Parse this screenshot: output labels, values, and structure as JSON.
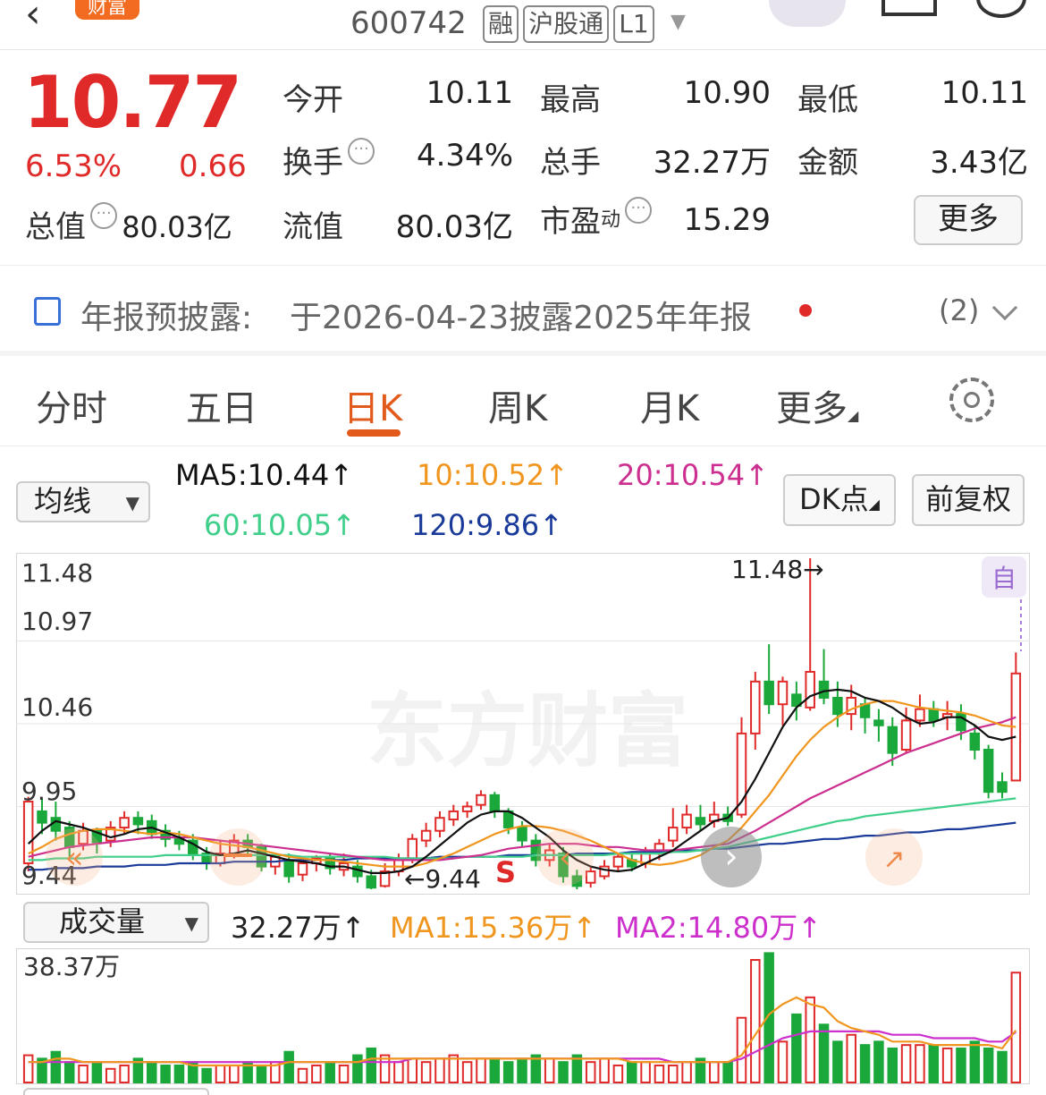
{
  "header": {
    "logo_text": "财富",
    "stock_code": "600742",
    "tags": [
      "融",
      "沪股通",
      "L1"
    ]
  },
  "quote": {
    "price": "10.77",
    "change_pct": "6.53%",
    "change_amt": "0.66",
    "market_cap_label": "总值",
    "market_cap": "80.03亿",
    "open_label": "今开",
    "open": "10.11",
    "high_label": "最高",
    "high": "10.90",
    "low_label": "最低",
    "low": "10.11",
    "turnover_label": "换手",
    "turnover": "4.34%",
    "volume_label": "总手",
    "volume": "32.27万",
    "amount_label": "金额",
    "amount": "3.43亿",
    "float_cap_label": "流值",
    "float_cap": "80.03亿",
    "pe_label": "市盈",
    "pe_sup": "动",
    "pe": "15.29",
    "more_label": "更多"
  },
  "notice": {
    "title": "年报预披露:",
    "text": "于2026-04-23披露2025年年报",
    "count": "(2)"
  },
  "tabs": [
    "分时",
    "五日",
    "日K",
    "周K",
    "月K",
    "更多"
  ],
  "active_tab": "日K",
  "indicators": {
    "select_label": "均线",
    "ma5": "MA5:10.44↑",
    "ma10": "10:10.52↑",
    "ma20": "20:10.54↑",
    "ma60": "60:10.05↑",
    "ma120": "120:9.86↑",
    "dk_label": "DK点",
    "adjust_label": "前复权"
  },
  "kchart": {
    "y_labels": [
      "11.48",
      "10.97",
      "10.46",
      "9.95",
      "9.44"
    ],
    "max_marker": "11.48→",
    "min_marker": "←9.44",
    "s_marker": "S",
    "auto_label": "自",
    "watermark": "东方财富"
  },
  "volume": {
    "select_label": "成交量",
    "current": "32.27万↑",
    "ma1": "MA1:15.36万↑",
    "ma2": "MA2:14.80万↑",
    "max_label": "38.37万"
  },
  "colors": {
    "up": "#e02a2a",
    "down": "#1aa83a",
    "ma5": "#111111",
    "ma10": "#f0961e",
    "ma20": "#cc2f8f",
    "ma60": "#3fcf8a",
    "ma120": "#1a3a9a",
    "accent": "#e25a1c"
  },
  "chart_data": {
    "type": "candlestick",
    "ylim": [
      9.44,
      11.48
    ],
    "candles": [
      {
        "o": 9.6,
        "c": 9.98,
        "h": 10.01,
        "l": 9.55
      },
      {
        "o": 9.92,
        "c": 9.85,
        "h": 10.0,
        "l": 9.78
      },
      {
        "o": 9.88,
        "c": 9.8,
        "h": 9.98,
        "l": 9.74
      },
      {
        "o": 9.82,
        "c": 9.7,
        "h": 9.86,
        "l": 9.64
      },
      {
        "o": 9.72,
        "c": 9.8,
        "h": 9.85,
        "l": 9.68
      },
      {
        "o": 9.8,
        "c": 9.73,
        "h": 9.82,
        "l": 9.66
      },
      {
        "o": 9.74,
        "c": 9.82,
        "h": 9.86,
        "l": 9.7
      },
      {
        "o": 9.82,
        "c": 9.88,
        "h": 9.92,
        "l": 9.78
      },
      {
        "o": 9.88,
        "c": 9.84,
        "h": 9.92,
        "l": 9.78
      },
      {
        "o": 9.86,
        "c": 9.78,
        "h": 9.9,
        "l": 9.75
      },
      {
        "o": 9.8,
        "c": 9.75,
        "h": 9.84,
        "l": 9.7
      },
      {
        "o": 9.76,
        "c": 9.72,
        "h": 9.8,
        "l": 9.68
      },
      {
        "o": 9.74,
        "c": 9.66,
        "h": 9.78,
        "l": 9.62
      },
      {
        "o": 9.66,
        "c": 9.6,
        "h": 9.7,
        "l": 9.56
      },
      {
        "o": 9.6,
        "c": 9.66,
        "h": 9.74,
        "l": 9.58
      },
      {
        "o": 9.66,
        "c": 9.74,
        "h": 9.78,
        "l": 9.63
      },
      {
        "o": 9.74,
        "c": 9.7,
        "h": 9.78,
        "l": 9.66
      },
      {
        "o": 9.7,
        "c": 9.58,
        "h": 9.72,
        "l": 9.55
      },
      {
        "o": 9.58,
        "c": 9.64,
        "h": 9.66,
        "l": 9.53
      },
      {
        "o": 9.62,
        "c": 9.52,
        "h": 9.66,
        "l": 9.48
      },
      {
        "o": 9.53,
        "c": 9.6,
        "h": 9.64,
        "l": 9.49
      },
      {
        "o": 9.6,
        "c": 9.63,
        "h": 9.65,
        "l": 9.55
      },
      {
        "o": 9.63,
        "c": 9.57,
        "h": 9.66,
        "l": 9.53
      },
      {
        "o": 9.56,
        "c": 9.6,
        "h": 9.66,
        "l": 9.52
      },
      {
        "o": 9.58,
        "c": 9.52,
        "h": 9.62,
        "l": 9.48
      },
      {
        "o": 9.52,
        "c": 9.45,
        "h": 9.56,
        "l": 9.44
      },
      {
        "o": 9.46,
        "c": 9.55,
        "h": 9.6,
        "l": 9.45
      },
      {
        "o": 9.55,
        "c": 9.63,
        "h": 9.66,
        "l": 9.52
      },
      {
        "o": 9.63,
        "c": 9.75,
        "h": 9.78,
        "l": 9.6
      },
      {
        "o": 9.74,
        "c": 9.8,
        "h": 9.85,
        "l": 9.7
      },
      {
        "o": 9.8,
        "c": 9.88,
        "h": 9.92,
        "l": 9.76
      },
      {
        "o": 9.87,
        "c": 9.92,
        "h": 9.96,
        "l": 9.83
      },
      {
        "o": 9.92,
        "c": 9.95,
        "h": 9.98,
        "l": 9.88
      },
      {
        "o": 9.96,
        "c": 10.02,
        "h": 10.05,
        "l": 9.93
      },
      {
        "o": 10.02,
        "c": 9.92,
        "h": 10.04,
        "l": 9.88
      },
      {
        "o": 9.92,
        "c": 9.82,
        "h": 9.94,
        "l": 9.78
      },
      {
        "o": 9.82,
        "c": 9.74,
        "h": 9.86,
        "l": 9.7
      },
      {
        "o": 9.74,
        "c": 9.62,
        "h": 9.78,
        "l": 9.58
      },
      {
        "o": 9.62,
        "c": 9.68,
        "h": 9.72,
        "l": 9.58
      },
      {
        "o": 9.66,
        "c": 9.52,
        "h": 9.7,
        "l": 9.48
      },
      {
        "o": 9.52,
        "c": 9.46,
        "h": 9.56,
        "l": 9.44
      },
      {
        "o": 9.48,
        "c": 9.55,
        "h": 9.58,
        "l": 9.45
      },
      {
        "o": 9.52,
        "c": 9.58,
        "h": 9.62,
        "l": 9.5
      },
      {
        "o": 9.58,
        "c": 9.64,
        "h": 9.66,
        "l": 9.55
      },
      {
        "o": 9.62,
        "c": 9.58,
        "h": 9.66,
        "l": 9.55
      },
      {
        "o": 9.6,
        "c": 9.66,
        "h": 9.7,
        "l": 9.57
      },
      {
        "o": 9.66,
        "c": 9.72,
        "h": 9.75,
        "l": 9.62
      },
      {
        "o": 9.74,
        "c": 9.82,
        "h": 9.94,
        "l": 9.7
      },
      {
        "o": 9.82,
        "c": 9.9,
        "h": 9.96,
        "l": 9.78
      },
      {
        "o": 9.88,
        "c": 9.84,
        "h": 9.96,
        "l": 9.8
      },
      {
        "o": 9.86,
        "c": 9.9,
        "h": 9.98,
        "l": 9.82
      },
      {
        "o": 9.9,
        "c": 9.86,
        "h": 9.95,
        "l": 9.83
      },
      {
        "o": 9.9,
        "c": 10.4,
        "h": 10.5,
        "l": 9.88
      },
      {
        "o": 10.4,
        "c": 10.72,
        "h": 10.78,
        "l": 10.3
      },
      {
        "o": 10.72,
        "c": 10.58,
        "h": 10.95,
        "l": 10.52
      },
      {
        "o": 10.58,
        "c": 10.72,
        "h": 10.75,
        "l": 10.45
      },
      {
        "o": 10.64,
        "c": 10.57,
        "h": 10.72,
        "l": 10.48
      },
      {
        "o": 10.56,
        "c": 10.78,
        "h": 11.48,
        "l": 10.54
      },
      {
        "o": 10.72,
        "c": 10.62,
        "h": 10.92,
        "l": 10.58
      },
      {
        "o": 10.62,
        "c": 10.52,
        "h": 10.72,
        "l": 10.44
      },
      {
        "o": 10.52,
        "c": 10.62,
        "h": 10.7,
        "l": 10.42
      },
      {
        "o": 10.58,
        "c": 10.5,
        "h": 10.62,
        "l": 10.4
      },
      {
        "o": 10.48,
        "c": 10.45,
        "h": 10.55,
        "l": 10.35
      },
      {
        "o": 10.44,
        "c": 10.28,
        "h": 10.5,
        "l": 10.2
      },
      {
        "o": 10.3,
        "c": 10.48,
        "h": 10.56,
        "l": 10.28
      },
      {
        "o": 10.48,
        "c": 10.55,
        "h": 10.64,
        "l": 10.44
      },
      {
        "o": 10.55,
        "c": 10.48,
        "h": 10.6,
        "l": 10.44
      },
      {
        "o": 10.5,
        "c": 10.52,
        "h": 10.6,
        "l": 10.42
      },
      {
        "o": 10.52,
        "c": 10.42,
        "h": 10.58,
        "l": 10.36
      },
      {
        "o": 10.4,
        "c": 10.3,
        "h": 10.45,
        "l": 10.24
      },
      {
        "o": 10.3,
        "c": 10.04,
        "h": 10.33,
        "l": 10.0
      },
      {
        "o": 10.1,
        "c": 10.04,
        "h": 10.16,
        "l": 10.0
      },
      {
        "o": 10.11,
        "c": 10.77,
        "h": 10.9,
        "l": 10.11
      }
    ],
    "ma5": [
      9.72,
      9.8,
      9.86,
      9.84,
      9.82,
      9.79,
      9.76,
      9.78,
      9.81,
      9.82,
      9.79,
      9.76,
      9.72,
      9.67,
      9.65,
      9.66,
      9.68,
      9.66,
      9.64,
      9.62,
      9.61,
      9.6,
      9.58,
      9.58,
      9.56,
      9.54,
      9.54,
      9.55,
      9.58,
      9.64,
      9.71,
      9.78,
      9.85,
      9.9,
      9.92,
      9.92,
      9.88,
      9.82,
      9.76,
      9.68,
      9.62,
      9.58,
      9.56,
      9.55,
      9.56,
      9.6,
      9.64,
      9.68,
      9.74,
      9.8,
      9.86,
      9.88,
      9.98,
      10.12,
      10.28,
      10.44,
      10.56,
      10.63,
      10.66,
      10.67,
      10.66,
      10.62,
      10.6,
      10.56,
      10.5,
      10.46,
      10.47,
      10.5,
      10.5,
      10.45,
      10.38,
      10.36,
      10.38
    ],
    "ma10": [
      9.66,
      9.7,
      9.75,
      9.78,
      9.8,
      9.81,
      9.81,
      9.8,
      9.79,
      9.78,
      9.79,
      9.78,
      9.76,
      9.74,
      9.72,
      9.71,
      9.7,
      9.68,
      9.66,
      9.64,
      9.63,
      9.62,
      9.62,
      9.61,
      9.6,
      9.59,
      9.58,
      9.58,
      9.58,
      9.6,
      9.63,
      9.66,
      9.7,
      9.74,
      9.78,
      9.81,
      9.83,
      9.83,
      9.82,
      9.8,
      9.77,
      9.74,
      9.7,
      9.66,
      9.62,
      9.6,
      9.59,
      9.6,
      9.62,
      9.65,
      9.7,
      9.74,
      9.82,
      9.92,
      10.02,
      10.14,
      10.26,
      10.36,
      10.44,
      10.5,
      10.55,
      10.58,
      10.6,
      10.6,
      10.58,
      10.56,
      10.55,
      10.54,
      10.53,
      10.51,
      10.48,
      10.45,
      10.44
    ],
    "ma20": [
      9.64,
      9.66,
      9.68,
      9.7,
      9.71,
      9.72,
      9.73,
      9.74,
      9.75,
      9.76,
      9.76,
      9.76,
      9.76,
      9.75,
      9.74,
      9.73,
      9.72,
      9.71,
      9.7,
      9.69,
      9.68,
      9.67,
      9.66,
      9.65,
      9.64,
      9.63,
      9.62,
      9.62,
      9.62,
      9.62,
      9.62,
      9.63,
      9.64,
      9.65,
      9.67,
      9.69,
      9.7,
      9.71,
      9.72,
      9.72,
      9.72,
      9.71,
      9.7,
      9.7,
      9.69,
      9.68,
      9.68,
      9.68,
      9.69,
      9.7,
      9.71,
      9.72,
      9.76,
      9.8,
      9.85,
      9.9,
      9.95,
      10.0,
      10.04,
      10.08,
      10.12,
      10.16,
      10.2,
      10.24,
      10.28,
      10.31,
      10.34,
      10.37,
      10.4,
      10.43,
      10.45,
      10.47,
      10.5
    ],
    "ma60": [
      9.62,
      9.62,
      9.63,
      9.63,
      9.63,
      9.64,
      9.64,
      9.64,
      9.64,
      9.64,
      9.65,
      9.65,
      9.65,
      9.65,
      9.65,
      9.65,
      9.65,
      9.65,
      9.65,
      9.65,
      9.64,
      9.64,
      9.64,
      9.64,
      9.64,
      9.64,
      9.64,
      9.63,
      9.63,
      9.63,
      9.63,
      9.63,
      9.64,
      9.64,
      9.64,
      9.64,
      9.64,
      9.65,
      9.65,
      9.65,
      9.65,
      9.65,
      9.65,
      9.66,
      9.66,
      9.66,
      9.66,
      9.67,
      9.67,
      9.68,
      9.69,
      9.7,
      9.72,
      9.74,
      9.76,
      9.78,
      9.8,
      9.82,
      9.84,
      9.86,
      9.87,
      9.89,
      9.9,
      9.91,
      9.92,
      9.93,
      9.94,
      9.95,
      9.96,
      9.97,
      9.98,
      9.99,
      10.0
    ],
    "ma120": [
      9.56,
      9.56,
      9.57,
      9.57,
      9.57,
      9.58,
      9.58,
      9.58,
      9.59,
      9.59,
      9.59,
      9.6,
      9.6,
      9.6,
      9.6,
      9.61,
      9.61,
      9.61,
      9.61,
      9.62,
      9.62,
      9.62,
      9.62,
      9.62,
      9.63,
      9.63,
      9.63,
      9.63,
      9.63,
      9.63,
      9.64,
      9.64,
      9.64,
      9.64,
      9.64,
      9.65,
      9.65,
      9.65,
      9.65,
      9.65,
      9.66,
      9.66,
      9.66,
      9.66,
      9.67,
      9.67,
      9.67,
      9.67,
      9.68,
      9.68,
      9.69,
      9.69,
      9.7,
      9.71,
      9.72,
      9.72,
      9.73,
      9.74,
      9.75,
      9.75,
      9.76,
      9.77,
      9.77,
      9.78,
      9.79,
      9.79,
      9.8,
      9.81,
      9.81,
      9.82,
      9.83,
      9.84,
      9.85
    ],
    "volume_wan": [
      8,
      7,
      9,
      6,
      5,
      6,
      4,
      5,
      7,
      6,
      5,
      5,
      6,
      4,
      5,
      5,
      6,
      5,
      6,
      9,
      4,
      5,
      6,
      5,
      8,
      10,
      8,
      6,
      7,
      6,
      7,
      8,
      6,
      7,
      7,
      6,
      7,
      8,
      7,
      6,
      8,
      6,
      7,
      5,
      6,
      6,
      5,
      5,
      6,
      7,
      6,
      6,
      19,
      36,
      38,
      12,
      20,
      25,
      17,
      12,
      14,
      11,
      12,
      10,
      11,
      11,
      11,
      10,
      10,
      12,
      10,
      9,
      32.27
    ],
    "vol_ma1": [
      6,
      6,
      7,
      7,
      6,
      6,
      6,
      6,
      6,
      6,
      6,
      6,
      5,
      5,
      5,
      5,
      5,
      5,
      5,
      6,
      6,
      6,
      6,
      6,
      6,
      7,
      7,
      7,
      7,
      7,
      7,
      7,
      7,
      7,
      7,
      7,
      7,
      7,
      7,
      7,
      7,
      7,
      7,
      7,
      6,
      6,
      6,
      6,
      6,
      6,
      6,
      6,
      8,
      14,
      20,
      23,
      25,
      23,
      22,
      18,
      16,
      15,
      14,
      12,
      12,
      12,
      11,
      11,
      11,
      11,
      11,
      10,
      15.36
    ],
    "vol_ma2": [
      6,
      6,
      6,
      6,
      6,
      6,
      6,
      6,
      6,
      6,
      6,
      6,
      6,
      6,
      6,
      6,
      6,
      6,
      6,
      6,
      6,
      6,
      6,
      6,
      6,
      6,
      6,
      6,
      7,
      7,
      7,
      7,
      7,
      7,
      7,
      7,
      7,
      7,
      7,
      7,
      7,
      7,
      7,
      7,
      7,
      7,
      7,
      6,
      6,
      6,
      6,
      6,
      7,
      9,
      11,
      13,
      14,
      15,
      15,
      15,
      15,
      15,
      15,
      14,
      14,
      14,
      13,
      13,
      13,
      13,
      12,
      12,
      14.8
    ]
  }
}
